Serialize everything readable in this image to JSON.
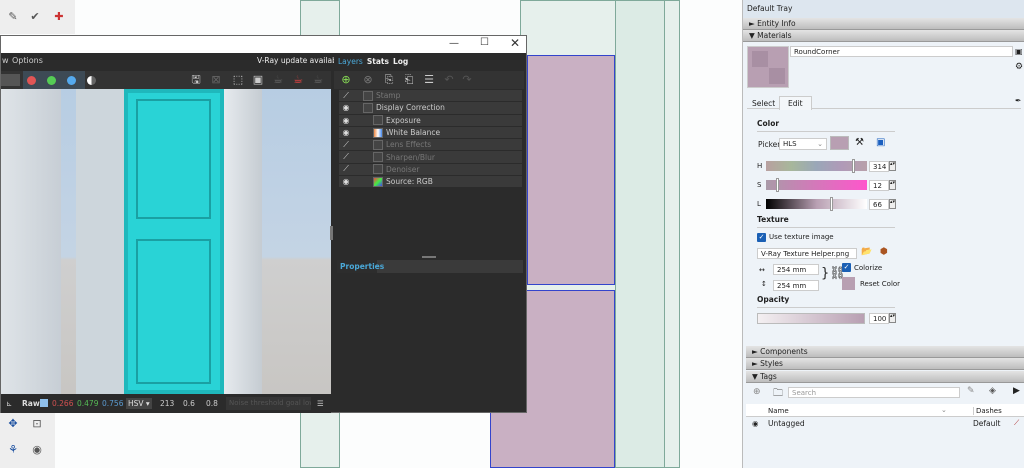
{
  "vfb": {
    "menu_partial": "w",
    "menu_options": "Options",
    "update_notice": "V-Ray update available!",
    "tabs": [
      "Layers",
      "Stats",
      "Log"
    ],
    "layers": [
      {
        "label": "Stamp",
        "enabled": false
      },
      {
        "label": "Display Correction",
        "enabled": true
      },
      {
        "label": "Exposure",
        "enabled": true
      },
      {
        "label": "White Balance",
        "enabled": true
      },
      {
        "label": "Lens Effects",
        "enabled": false
      },
      {
        "label": "Sharpen/Blur",
        "enabled": false
      },
      {
        "label": "Denoiser",
        "enabled": false
      },
      {
        "label": "Source: RGB",
        "enabled": true
      }
    ],
    "properties_label": "Properties",
    "status": {
      "mode": "Raw",
      "r": "0.266",
      "g": "0.479",
      "b": "0.756",
      "space": "HSV",
      "h": "213",
      "s": "0.6",
      "v": "0.8",
      "message": "Noise threshold goal lower"
    },
    "colors": {
      "red": "#e05555",
      "green": "#55cc55",
      "blue": "#55aaee",
      "accent": "#4aa8d8"
    }
  },
  "tray": {
    "title": "Default Tray",
    "sections": {
      "entity_info": "Entity Info",
      "materials": "Materials",
      "components": "Components",
      "styles": "Styles",
      "tags": "Tags"
    },
    "material_name": "RoundCorner",
    "material_color": "#b89fb2",
    "tabs": [
      "Select",
      "Edit"
    ],
    "color_label": "Color",
    "picker_label": "Picker:",
    "picker_value": "HLS",
    "h_label": "H",
    "h": "314",
    "s_label": "S",
    "s": "12",
    "l_label": "L",
    "l": "66",
    "texture_label": "Texture",
    "use_texture": "Use texture image",
    "texture_file": "V-Ray Texture Helper.png",
    "width": "254 mm",
    "height": "254 mm",
    "colorize": "Colorize",
    "reset_color": "Reset Color",
    "opacity_label": "Opacity",
    "opacity": "100",
    "tags_search_placeholder": "Search",
    "col_name": "Name",
    "col_dashes": "Dashes",
    "tag_rows": [
      {
        "name": "Untagged",
        "dashes": "Default"
      }
    ]
  }
}
